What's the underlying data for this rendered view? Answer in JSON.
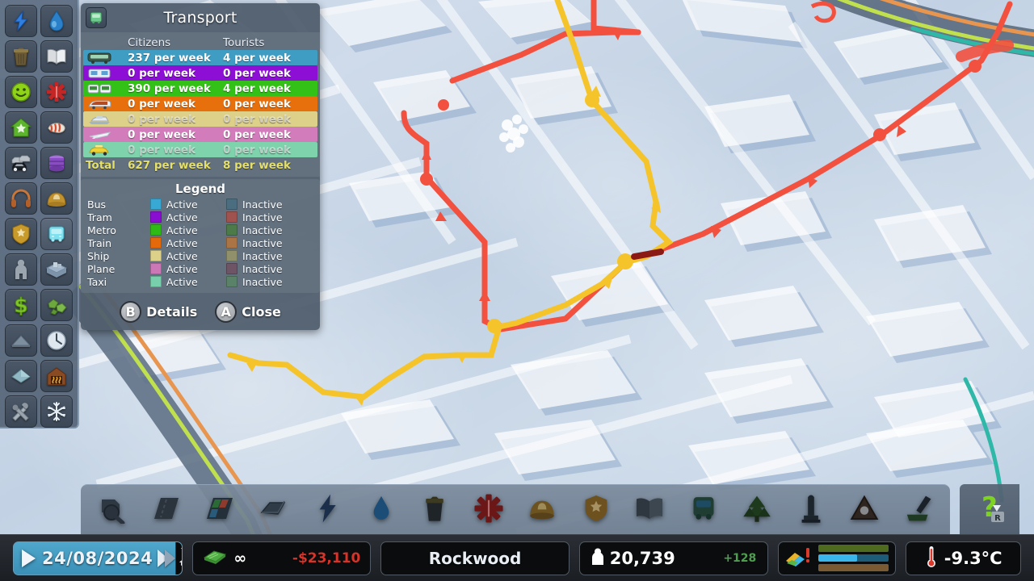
{
  "panel": {
    "title": "Transport",
    "icon": "bus-icon",
    "columns": {
      "icon": "",
      "citizens": "Citizens",
      "tourists": "Tourists"
    },
    "rows": [
      {
        "mode": "bus",
        "icon": "bus-icon",
        "citizens": "237 per week",
        "tourists": "4 per week",
        "color": "#3f9dc4",
        "active": true
      },
      {
        "mode": "tram",
        "icon": "tram-icon",
        "citizens": "0 per week",
        "tourists": "0 per week",
        "color": "#8d0fd6",
        "active": true
      },
      {
        "mode": "metro",
        "icon": "metro-icon",
        "citizens": "390 per week",
        "tourists": "4 per week",
        "color": "#33c017",
        "active": true
      },
      {
        "mode": "train",
        "icon": "train-icon",
        "citizens": "0 per week",
        "tourists": "0 per week",
        "color": "#e8700c",
        "active": true
      },
      {
        "mode": "ship",
        "icon": "ship-icon",
        "citizens": "0 per week",
        "tourists": "0 per week",
        "color": "#ddd089",
        "active": false
      },
      {
        "mode": "plane",
        "icon": "plane-icon",
        "citizens": "0 per week",
        "tourists": "0 per week",
        "color": "#d27cbb",
        "active": true
      },
      {
        "mode": "taxi",
        "icon": "taxi-icon",
        "citizens": "0 per week",
        "tourists": "0 per week",
        "color": "#7ed3ad",
        "active": false
      }
    ],
    "total": {
      "label": "Total",
      "citizens": "627 per week",
      "tourists": "8 per week"
    },
    "legend": {
      "title": "Legend",
      "active_label": "Active",
      "inactive_label": "Inactive",
      "items": [
        {
          "name": "Bus",
          "active_color": "#38a8d4",
          "inactive_color": "#4b6d80"
        },
        {
          "name": "Tram",
          "active_color": "#8a0ed2",
          "inactive_color": "#a0524f"
        },
        {
          "name": "Metro",
          "active_color": "#2fbb15",
          "inactive_color": "#4c7a48"
        },
        {
          "name": "Train",
          "active_color": "#e3690b",
          "inactive_color": "#ab7445"
        },
        {
          "name": "Ship",
          "active_color": "#ddd089",
          "inactive_color": "#90906a"
        },
        {
          "name": "Plane",
          "active_color": "#cc77b6",
          "inactive_color": "#6e5566"
        },
        {
          "name": "Taxi",
          "active_color": "#77d0ab",
          "inactive_color": "#5a8268"
        }
      ]
    },
    "buttons": [
      {
        "key": "B",
        "label": "Details"
      },
      {
        "key": "A",
        "label": "Close"
      }
    ]
  },
  "infoviews": {
    "items": [
      {
        "name": "electricity",
        "icon": "lightning-bolt-icon"
      },
      {
        "name": "water",
        "icon": "water-drop-icon"
      },
      {
        "name": "garbage",
        "icon": "trash-bin-icon"
      },
      {
        "name": "education",
        "icon": "open-book-icon"
      },
      {
        "name": "happiness",
        "icon": "smiley-face-icon"
      },
      {
        "name": "healthcare",
        "icon": "medical-cross-icon"
      },
      {
        "name": "landvalue",
        "icon": "house-star-icon"
      },
      {
        "name": "noise",
        "icon": "megaphone-icon"
      },
      {
        "name": "traffic",
        "icon": "cars-icon"
      },
      {
        "name": "pollution",
        "icon": "barrel-icon"
      },
      {
        "name": "entertainment",
        "icon": "headphones-icon"
      },
      {
        "name": "firesafety",
        "icon": "fire-helmet-icon"
      },
      {
        "name": "crime",
        "icon": "police-badge-icon"
      },
      {
        "name": "transport",
        "icon": "bus-icon"
      },
      {
        "name": "population",
        "icon": "person-icon"
      },
      {
        "name": "districts",
        "icon": "districts-icon"
      },
      {
        "name": "outsidecon",
        "icon": "dollar-icon"
      },
      {
        "name": "naturalres",
        "icon": "ore-icon"
      },
      {
        "name": "terrain",
        "icon": "landscape-icon"
      },
      {
        "name": "routes",
        "icon": "clock-icon"
      },
      {
        "name": "wind",
        "icon": "wind-icon"
      },
      {
        "name": "heating",
        "icon": "heating-icon"
      },
      {
        "name": "maintenance",
        "icon": "tools-icon"
      },
      {
        "name": "snow",
        "icon": "snowflake-icon"
      }
    ]
  },
  "toolbar": {
    "items": [
      {
        "name": "bulldozer",
        "icon": "bulldozer-icon"
      },
      {
        "name": "roads",
        "icon": "road-icon"
      },
      {
        "name": "zoning",
        "icon": "zoning-icon"
      },
      {
        "name": "districts",
        "icon": "district-paint-icon"
      },
      {
        "name": "electricity",
        "icon": "lightning-bolt-icon"
      },
      {
        "name": "water-sewage",
        "icon": "water-drop-icon"
      },
      {
        "name": "garbage",
        "icon": "trash-bin-icon"
      },
      {
        "name": "healthcare",
        "icon": "medical-cross-icon"
      },
      {
        "name": "firedept",
        "icon": "fire-helmet-icon"
      },
      {
        "name": "police",
        "icon": "police-badge-icon"
      },
      {
        "name": "education",
        "icon": "open-book-icon"
      },
      {
        "name": "transport",
        "icon": "bus-icon"
      },
      {
        "name": "parks",
        "icon": "tree-icon"
      },
      {
        "name": "monuments",
        "icon": "monument-icon"
      },
      {
        "name": "wonders",
        "icon": "triangle-icon"
      },
      {
        "name": "landscaping",
        "icon": "shovel-icon"
      }
    ],
    "help": {
      "name": "help",
      "icon": "question-mark-icon",
      "hint": "R"
    }
  },
  "statusbar": {
    "date": "24/08/2024",
    "play_icon": "play-icon",
    "fastforward_icon": "fast-forward-icon",
    "unlock_icon": "milestone-icon",
    "money_icon": "money-stack-icon",
    "money_unlimited": "∞",
    "money_value": "-$23,110",
    "money_color": "#d4342a",
    "city_name": "Rockwood",
    "population_icon": "person-icon",
    "population": "20,739",
    "population_delta": "+128",
    "population_delta_color": "#4f9e4f",
    "demand_icon": "demand-icon",
    "demand_alert_icon": "exclamation-icon",
    "demand": [
      {
        "name": "commercial",
        "color": "#4e6a1f",
        "value": 100
      },
      {
        "name": "residential",
        "color": "#3ab6ea",
        "track": "#1c5c78",
        "value": 55
      },
      {
        "name": "industrial",
        "color": "#7a5a33",
        "value": 100
      }
    ],
    "temperature_icon": "thermometer-icon",
    "temperature": "-9.3°C"
  }
}
